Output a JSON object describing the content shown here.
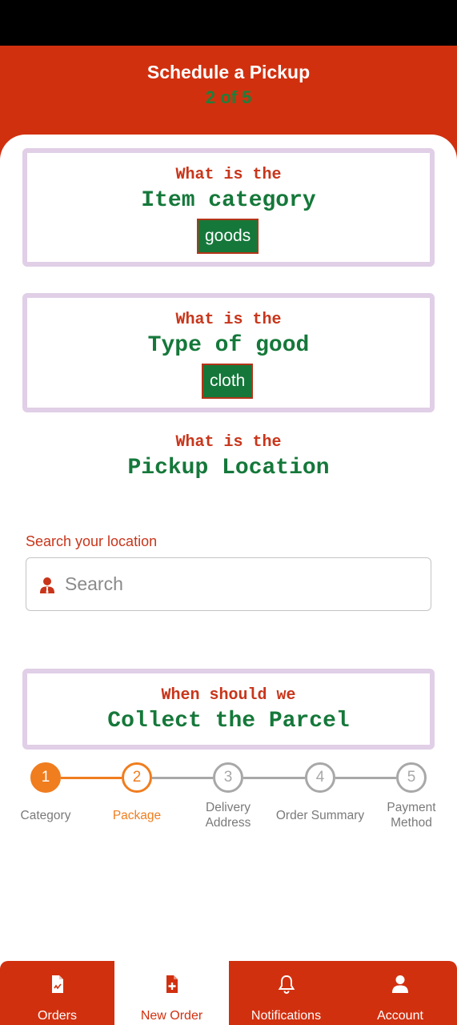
{
  "header": {
    "title": "Schedule a Pickup",
    "step": "2 of 5"
  },
  "questions": {
    "item_category": {
      "prefix": "What is the",
      "title": "Item category",
      "answer": "goods"
    },
    "type_of_good": {
      "prefix": "What is the",
      "title": "Type of good",
      "answer": "cloth"
    },
    "pickup_location": {
      "prefix": "What is the",
      "title": "Pickup Location"
    },
    "collect": {
      "prefix": "When should we",
      "title": "Collect the Parcel"
    }
  },
  "search": {
    "label": "Search your location",
    "placeholder": "Search",
    "value": ""
  },
  "stepper": {
    "current": 2,
    "steps": [
      {
        "number": "1",
        "label": "Category",
        "state": "done"
      },
      {
        "number": "2",
        "label": "Package",
        "state": "active"
      },
      {
        "number": "3",
        "label": "Delivery Address",
        "label_line1": "Delivery",
        "label_line2": "Address",
        "state": "pending"
      },
      {
        "number": "4",
        "label": "Order Summary",
        "state": "pending"
      },
      {
        "number": "5",
        "label": "Payment Method",
        "label_line1": "Payment",
        "label_line2": "Method",
        "state": "pending"
      }
    ]
  },
  "nav": {
    "items": [
      {
        "label": "Orders",
        "icon": "document-icon"
      },
      {
        "label": "New Order",
        "icon": "add-document-icon",
        "active": true
      },
      {
        "label": "Notifications",
        "icon": "bell-icon"
      },
      {
        "label": "Account",
        "icon": "user-icon"
      }
    ]
  },
  "colors": {
    "brand_red": "#d1300f",
    "green": "#15783a",
    "orange": "#f07d1e",
    "card_border": "#e0cfe6",
    "pending_gray": "#a8a8a8"
  }
}
